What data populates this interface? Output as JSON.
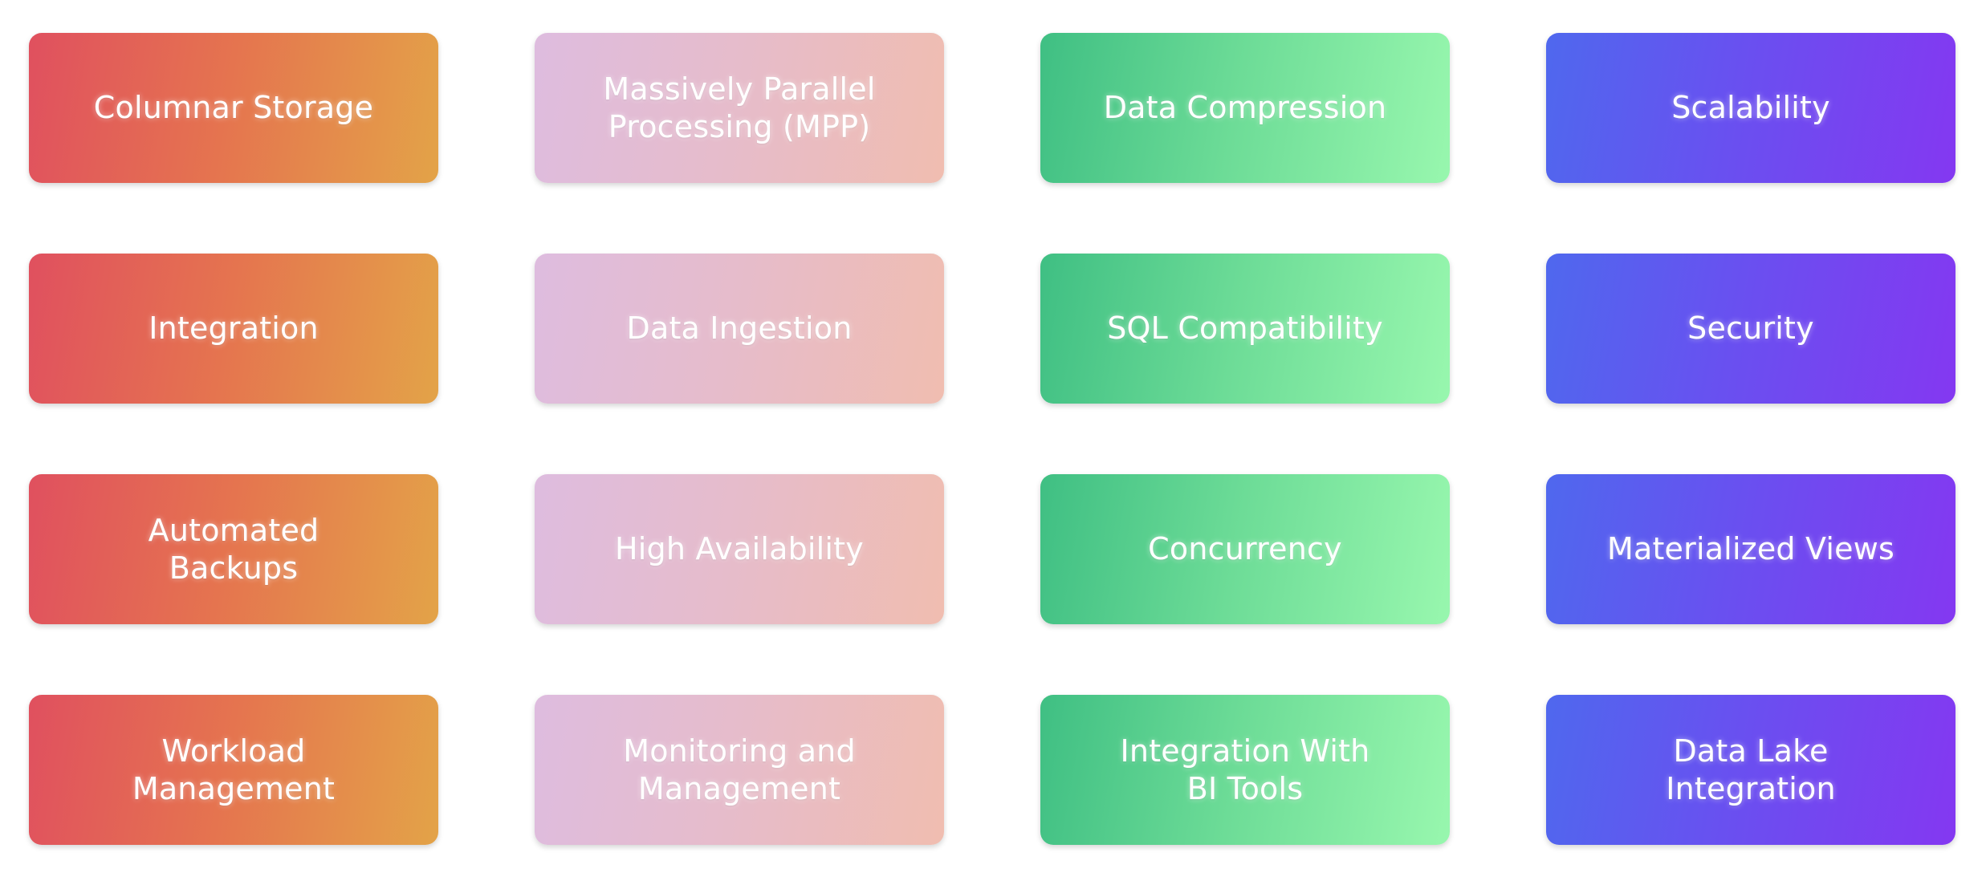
{
  "page": {
    "background_color": "#ffffff",
    "layout": "4x4-card-grid",
    "columns": 4,
    "rows": 4
  },
  "themes": {
    "warm": {
      "name": "warm",
      "from": "#e0505f",
      "mid": "#e5744f",
      "to": "#e3a348"
    },
    "blush": {
      "name": "blush",
      "from": "#debcdf",
      "mid": "#e6bccb",
      "to": "#f0bdb0"
    },
    "mint": {
      "name": "mint",
      "from": "#3fbf83",
      "mid": "#6ddc97",
      "to": "#98f7ae"
    },
    "violet": {
      "name": "violet",
      "from": "#4f68ee",
      "mid": "#6a4ff0",
      "to": "#8438f1"
    }
  },
  "cards": [
    {
      "id": "columnar-storage",
      "label": "Columnar Storage",
      "theme": "warm",
      "row": 1,
      "column": 1
    },
    {
      "id": "massively-parallel-processing",
      "label": "Massively Parallel\nProcessing (MPP)",
      "theme": "blush",
      "row": 1,
      "column": 2
    },
    {
      "id": "data-compression",
      "label": "Data Compression",
      "theme": "mint",
      "row": 1,
      "column": 3
    },
    {
      "id": "scalability",
      "label": "Scalability",
      "theme": "violet",
      "row": 1,
      "column": 4
    },
    {
      "id": "integration",
      "label": "Integration",
      "theme": "warm",
      "row": 2,
      "column": 1
    },
    {
      "id": "data-ingestion",
      "label": "Data Ingestion",
      "theme": "blush",
      "row": 2,
      "column": 2
    },
    {
      "id": "sql-compatibility",
      "label": "SQL Compatibility",
      "theme": "mint",
      "row": 2,
      "column": 3
    },
    {
      "id": "security",
      "label": "Security",
      "theme": "violet",
      "row": 2,
      "column": 4
    },
    {
      "id": "automated-backups",
      "label": "Automated\nBackups",
      "theme": "warm",
      "row": 3,
      "column": 1
    },
    {
      "id": "high-availability",
      "label": "High Availability",
      "theme": "blush",
      "row": 3,
      "column": 2
    },
    {
      "id": "concurrency",
      "label": "Concurrency",
      "theme": "mint",
      "row": 3,
      "column": 3
    },
    {
      "id": "materialized-views",
      "label": "Materialized Views",
      "theme": "violet",
      "row": 3,
      "column": 4
    },
    {
      "id": "workload-management",
      "label": "Workload\nManagement",
      "theme": "warm",
      "row": 4,
      "column": 1
    },
    {
      "id": "monitoring-and-management",
      "label": "Monitoring and\nManagement",
      "theme": "blush",
      "row": 4,
      "column": 2
    },
    {
      "id": "integration-with-bi-tools",
      "label": "Integration With\nBI Tools",
      "theme": "mint",
      "row": 4,
      "column": 3
    },
    {
      "id": "data-lake-integration",
      "label": "Data Lake\nIntegration",
      "theme": "violet",
      "row": 4,
      "column": 4
    }
  ]
}
